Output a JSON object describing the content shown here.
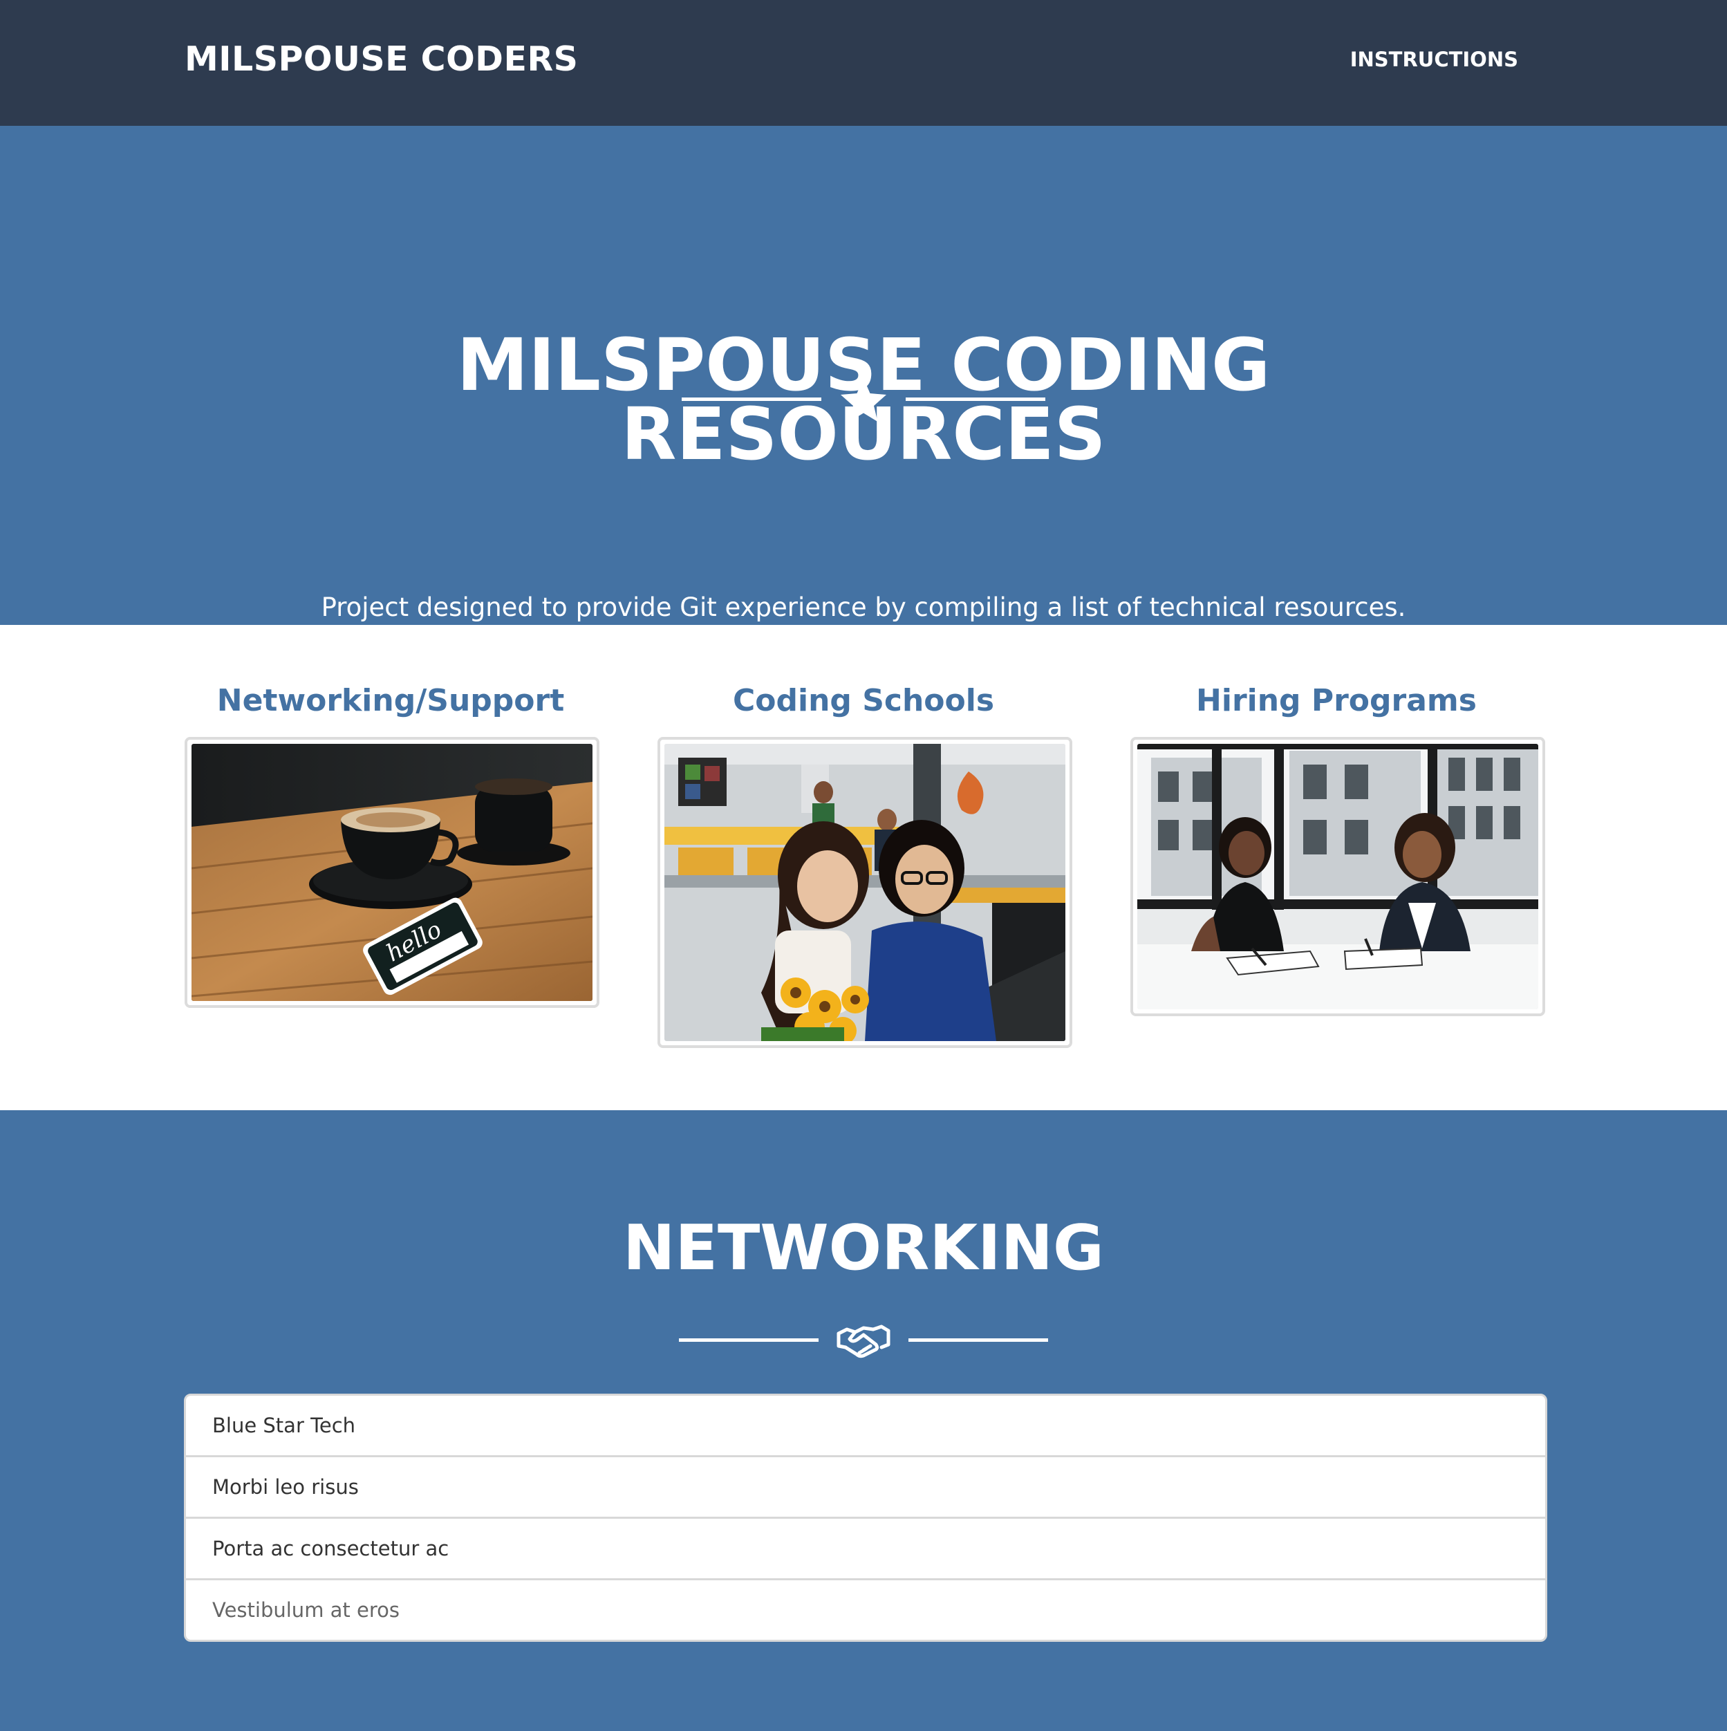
{
  "navbar": {
    "brand": "MILSPOUSE CODERS",
    "link": "INSTRUCTIONS"
  },
  "hero": {
    "title_line1": "MILSPOUSE CODING",
    "title_line2": "RESOURCES",
    "divider_icon": "star-icon",
    "subtitle": "Project designed to provide Git experience by compiling a list of technical resources."
  },
  "categories": [
    {
      "title": "Networking/Support",
      "image": "coffee-cups-hello-sticker-photo"
    },
    {
      "title": "Coding Schools",
      "image": "students-in-classroom-photo"
    },
    {
      "title": "Hiring Programs",
      "image": "two-women-meeting-photo"
    }
  ],
  "networking": {
    "title": "NETWORKING",
    "divider_icon": "handshake-icon",
    "items": [
      "Blue Star Tech",
      "Morbi leo risus",
      "Porta ac consectetur ac",
      "Vestibulum at eros"
    ]
  },
  "colors": {
    "navbar_bg": "#2e3b4f",
    "primary": "#4472a3",
    "white": "#ffffff"
  }
}
